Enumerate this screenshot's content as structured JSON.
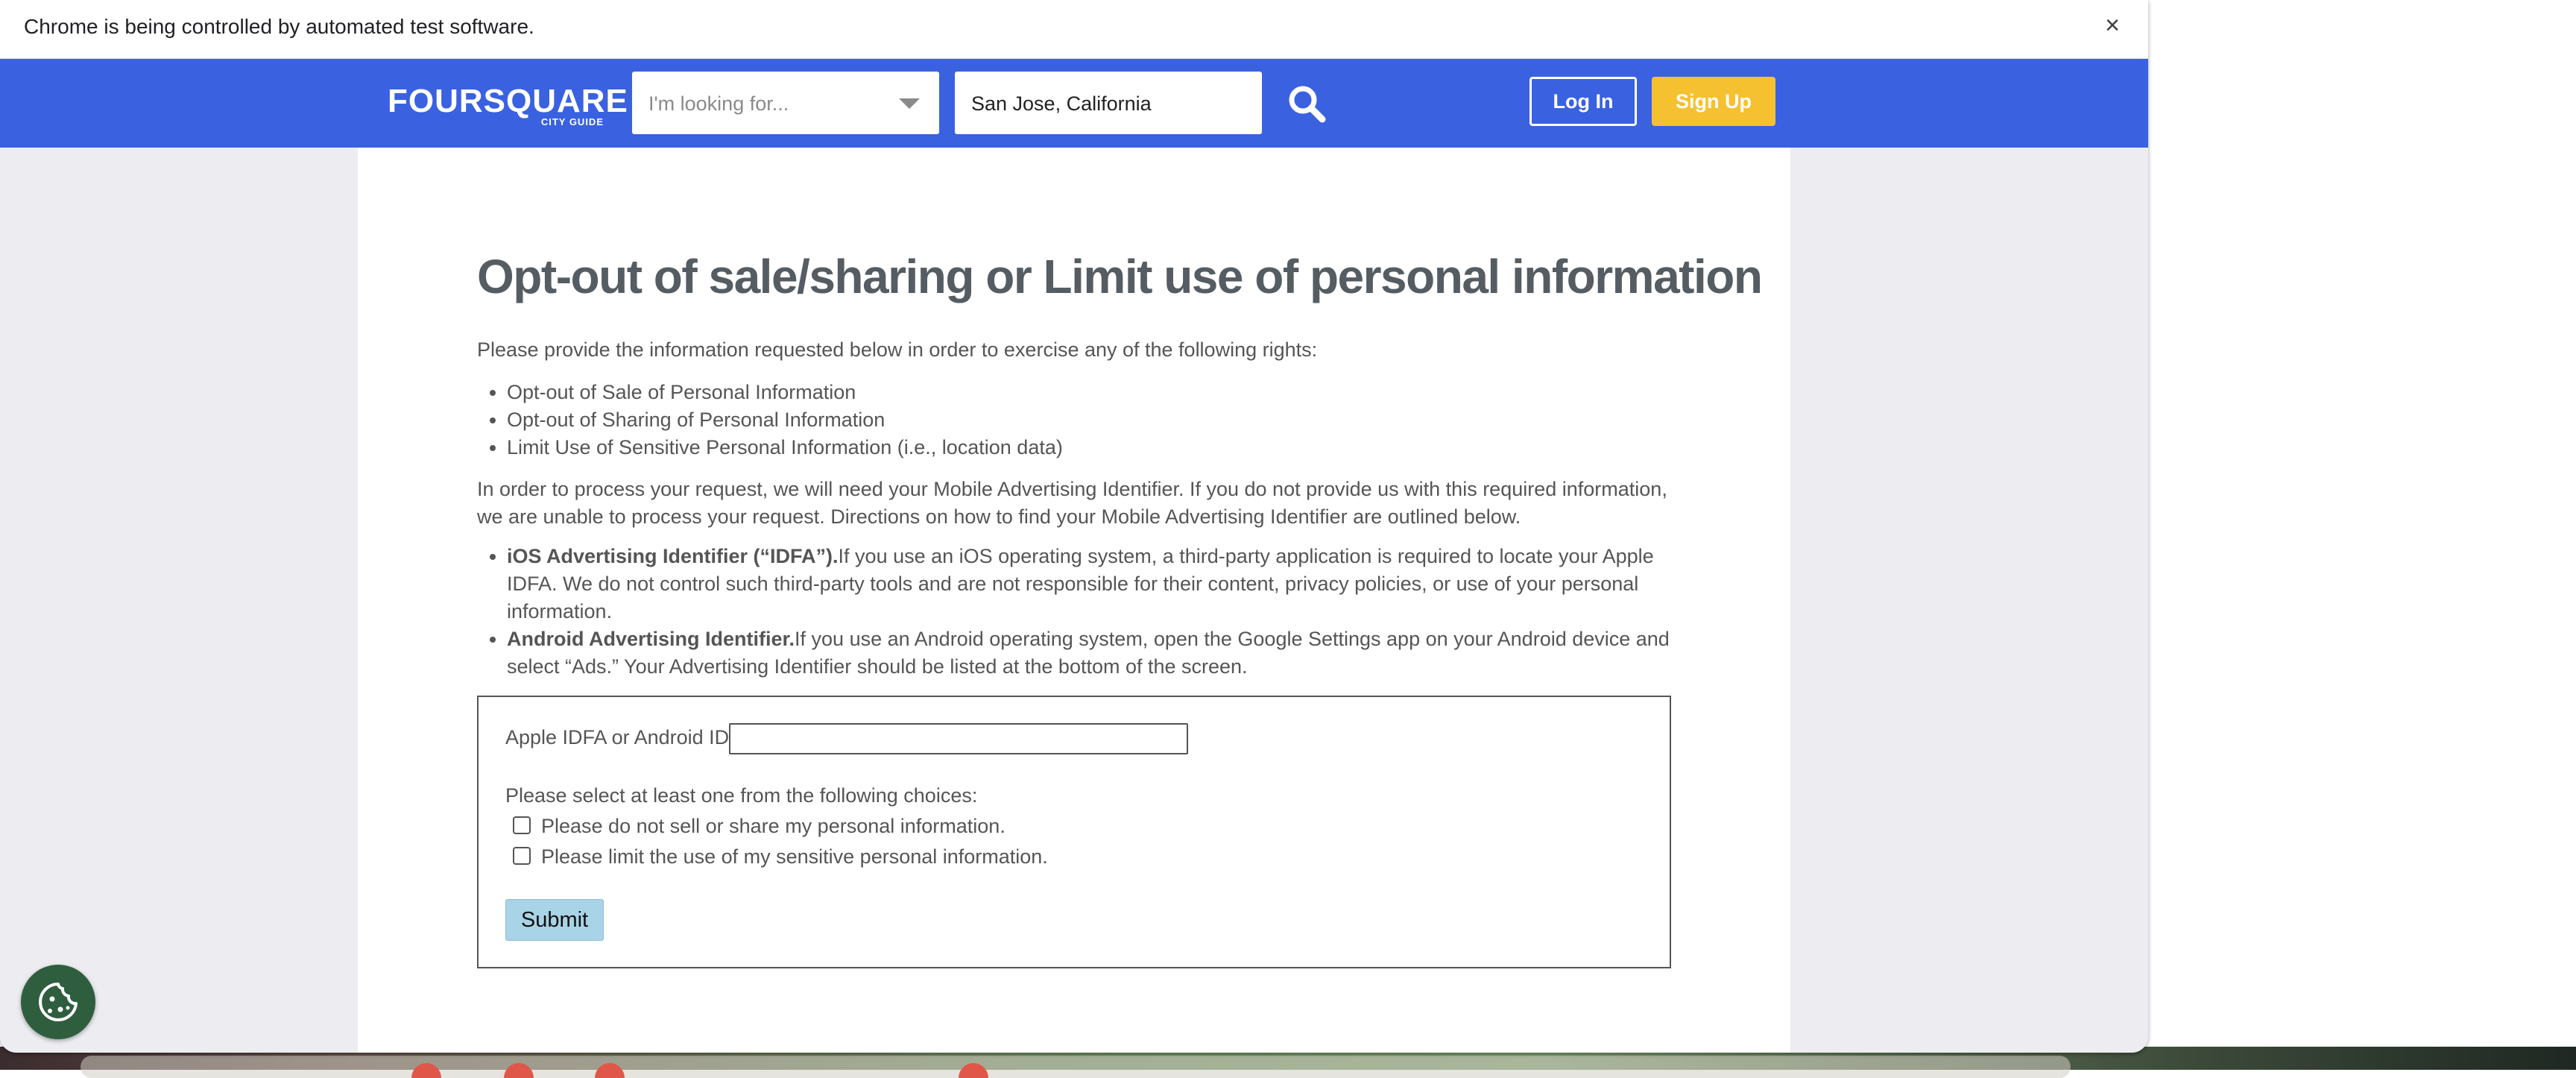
{
  "browser": {
    "infobar_text": "Chrome is being controlled by automated test software.",
    "close_symbol": "×"
  },
  "header": {
    "logo_main": "FOURSQUARE",
    "logo_sub": "CITY GUIDE",
    "search_placeholder": "I'm looking for...",
    "location_value": "San Jose, California",
    "search_icon": "search-icon",
    "login_label": "Log In",
    "signup_label": "Sign Up",
    "brand_color": "#3a61e0",
    "signup_color": "#f5c130"
  },
  "main": {
    "title": "Opt-out of sale/sharing or Limit use of personal information",
    "intro": "Please provide the information requested below in order to exercise any of the following rights:",
    "rights": [
      "Opt-out of Sale of Personal Information",
      "Opt-out of Sharing of Personal Information",
      "Limit Use of Sensitive Personal Information (i.e., location data)"
    ],
    "paragraph": "In order to process your request, we will need your Mobile Advertising Identifier. If you do not provide us with this required information, we are unable to process your request. Directions on how to find your Mobile Advertising Identifier are outlined below.",
    "ids": [
      {
        "heading": "iOS Advertising Identifier (“IDFA”).",
        "text": "If you use an iOS operating system, a third-party application is required to locate your Apple IDFA. We do not control such third-party tools and are not responsible for their content, privacy policies, or use of your personal information."
      },
      {
        "heading": "Android Advertising Identifier.",
        "text": "If you use an Android operating system, open the Google Settings app on your Android device and select “Ads.” Your Advertising Identifier should be listed at the bottom of the screen."
      }
    ]
  },
  "form": {
    "idfa_label": "Apple IDFA or Android ID",
    "idfa_value": "",
    "choices_label": "Please select at least one from the following choices:",
    "choice_1": "Please do not sell or share my personal information.",
    "choice_2": "Please limit the use of my sensitive personal information.",
    "submit_label": "Submit"
  },
  "cookie": {
    "icon": "cookie-icon"
  }
}
